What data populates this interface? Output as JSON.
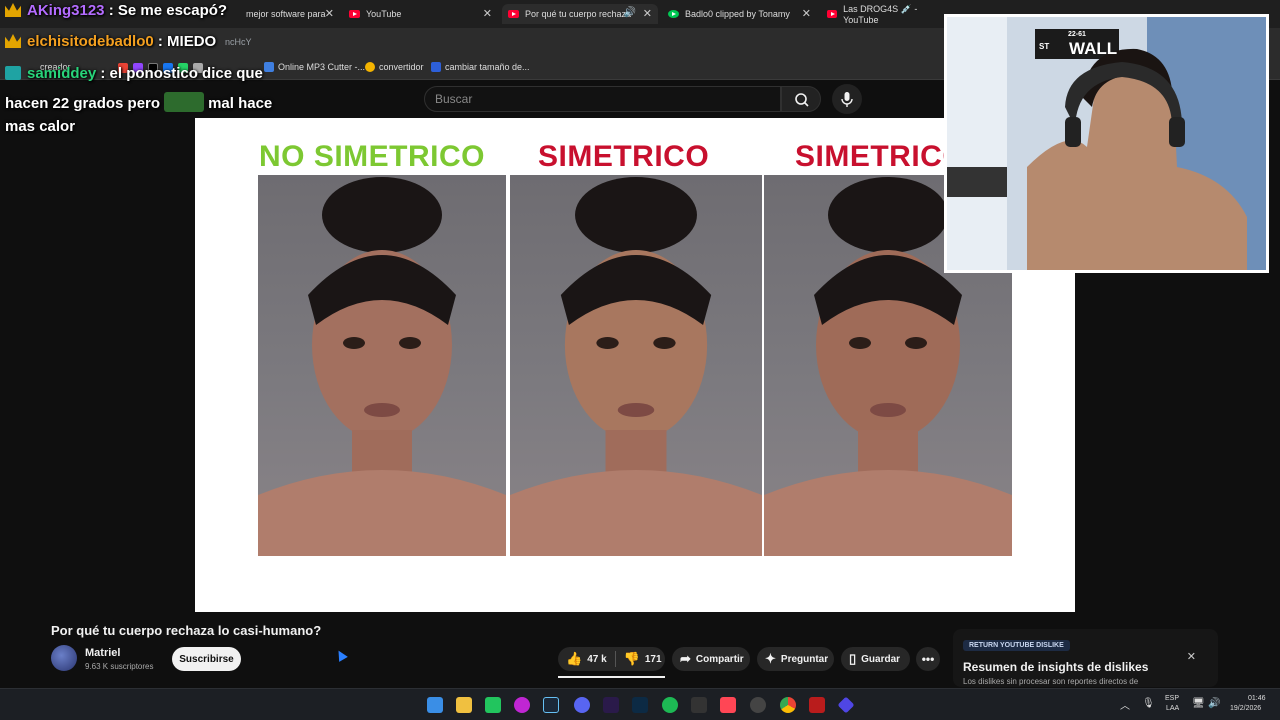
{
  "browser": {
    "tabs": [
      {
        "label": "mejor software para"
      },
      {
        "label": "YouTube"
      },
      {
        "label": "Por qué tu cuerpo rechaza"
      },
      {
        "label": "Badlo0 clipped by Tonamy"
      },
      {
        "label": "Las DROG4S 💉 - YouTube"
      }
    ],
    "url_fragment": "ncHcY",
    "bookmarks": [
      {
        "label": "creador"
      },
      {
        "label": "Online MP3 Cutter -..."
      },
      {
        "label": "convertidor"
      },
      {
        "label": "cambiar tamaño de..."
      }
    ]
  },
  "youtube": {
    "search_placeholder": "Buscar",
    "video": {
      "labels": [
        {
          "text": "NO SIMETRICO",
          "color": "#7dc832"
        },
        {
          "text": "SIMETRICO",
          "color": "#c8102e"
        },
        {
          "text": "SIMETRICO",
          "color": "#c8102e"
        }
      ]
    },
    "title": "Por qué tu cuerpo rechaza lo casi-humano?",
    "channel": {
      "name": "Matriel",
      "subscribers": "9.63 K suscriptores"
    },
    "subscribe_label": "Suscribirse",
    "actions": {
      "likes": "47 k",
      "dislikes": "171",
      "share": "Compartir",
      "ask": "Preguntar",
      "save": "Guardar"
    },
    "dislike_card": {
      "badge": "RETURN YOUTUBE DISLIKE",
      "title": "Resumen de insights de dislikes",
      "subtitle": "Los dislikes sin procesar son reportes directos de"
    }
  },
  "chat": [
    {
      "user": "AKing3123",
      "message": ": Se me escapó?",
      "user_color": "#b46cff"
    },
    {
      "user": "elchisitodebadlo0",
      "message": ": MIEDO",
      "user_color": "#f4a020"
    },
    {
      "user": "samiddey",
      "message": ": el ponostico dice que",
      "user_color": "#28d47a"
    },
    {
      "continuation_a": "hacen 22 grados pero",
      "continuation_b": "mal hace"
    },
    {
      "continuation": "mas calor"
    }
  ],
  "webcam": {
    "sign_text": "WALL",
    "sign_small": "22-61",
    "sign_st": "ST"
  },
  "taskbar": {
    "language": "ESP",
    "language_sub": "LAA",
    "time": "01:46",
    "date": "19/2/2026"
  }
}
